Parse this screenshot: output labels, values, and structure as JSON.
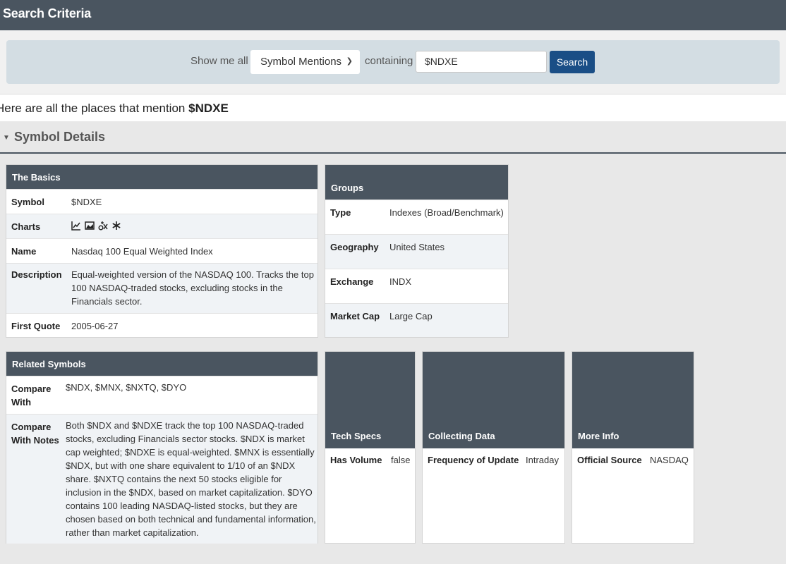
{
  "header": {
    "title": "Search Criteria"
  },
  "search": {
    "show_label": "Show me all",
    "select_value": "Symbol Mentions",
    "containing_label": "containing",
    "input_value": "$NDXE",
    "button_label": "Search"
  },
  "mention": {
    "intro": "Here are all the places that mention ",
    "symbol": "$NDXE"
  },
  "section": {
    "title": "Symbol Details"
  },
  "basics": {
    "title": "The Basics",
    "symbol_key": "Symbol",
    "symbol_val": "$NDXE",
    "charts_key": "Charts",
    "name_key": "Name",
    "name_val": "Nasdaq 100 Equal Weighted Index",
    "desc_key": "Description",
    "desc_val": "Equal-weighted version of the NASDAQ 100. Tracks the top 100 NASDAQ-traded stocks, excluding stocks in the Financials sector.",
    "first_key": "First Quote",
    "first_val": "2005-06-27"
  },
  "groups": {
    "title": "Groups",
    "type_key": "Type",
    "type_val": "Indexes (Broad/Benchmark)",
    "geo_key": "Geography",
    "geo_val": "United States",
    "exch_key": "Exchange",
    "exch_val": "INDX",
    "cap_key": "Market Cap",
    "cap_val": "Large Cap"
  },
  "related": {
    "title": "Related Symbols",
    "compare_key": "Compare With",
    "compare_val": "$NDX, $MNX, $NXTQ, $DYO",
    "notes_key": "Compare With Notes",
    "notes_val": "Both $NDX and $NDXE track the top 100 NASDAQ-traded stocks, excluding Financials sector stocks. $NDX is market cap weighted; $NDXE is equal-weighted. $MNX is essentially $NDX, but with one share equivalent to 1/10 of an $NDX share. $NXTQ contains the next 50 stocks eligible for inclusion in the $NDX, based on market capitalization. $DYO contains 100 leading NASDAQ-listed stocks, but they are chosen based on both technical and fundamental information, rather than market capitalization."
  },
  "tech": {
    "title": "Tech Specs",
    "key": "Has Volume",
    "val": "false"
  },
  "collecting": {
    "title": "Collecting Data",
    "key": "Frequency of Update",
    "val": "Intraday"
  },
  "more": {
    "title": "More Info",
    "key": "Official Source",
    "val": "NASDAQ"
  },
  "icons": [
    "line-chart-icon",
    "area-chart-icon",
    "options-chart-icon",
    "seasonality-icon"
  ]
}
